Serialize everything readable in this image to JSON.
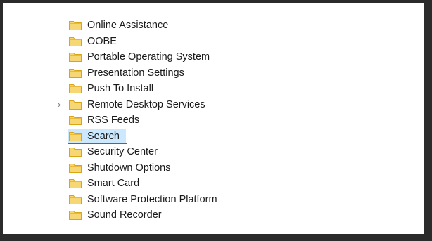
{
  "tree": {
    "items": [
      {
        "label": "Online Assistance",
        "expandable": false,
        "selected": false
      },
      {
        "label": "OOBE",
        "expandable": false,
        "selected": false
      },
      {
        "label": "Portable Operating System",
        "expandable": false,
        "selected": false
      },
      {
        "label": "Presentation Settings",
        "expandable": false,
        "selected": false
      },
      {
        "label": "Push To Install",
        "expandable": false,
        "selected": false
      },
      {
        "label": "Remote Desktop Services",
        "expandable": true,
        "selected": false
      },
      {
        "label": "RSS Feeds",
        "expandable": false,
        "selected": false
      },
      {
        "label": "Search",
        "expandable": false,
        "selected": true
      },
      {
        "label": "Security Center",
        "expandable": false,
        "selected": false
      },
      {
        "label": "Shutdown Options",
        "expandable": false,
        "selected": false
      },
      {
        "label": "Smart Card",
        "expandable": false,
        "selected": false
      },
      {
        "label": "Software Protection Platform",
        "expandable": false,
        "selected": false
      },
      {
        "label": "Sound Recorder",
        "expandable": false,
        "selected": false
      }
    ],
    "icon": "folder-icon",
    "expand_icon": "chevron-right-icon",
    "colors": {
      "selection_bg": "#cce8ff",
      "focus_underline": "#0f8c80",
      "folder_fill": "#f7d774",
      "folder_stroke": "#d9a514"
    }
  }
}
